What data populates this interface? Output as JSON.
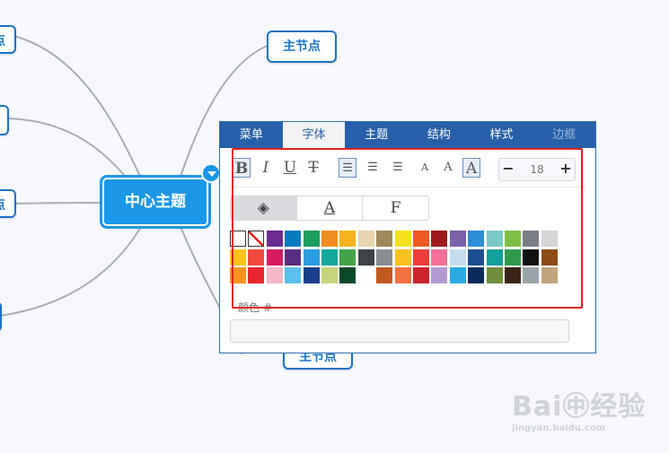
{
  "mindmap": {
    "center_topic": "中心主题",
    "node_top_right": "主节点",
    "node_bottom_right": "主节点",
    "left_node_fragment": "点"
  },
  "panel": {
    "tabs": [
      {
        "label": "菜单",
        "active": false
      },
      {
        "label": "字体",
        "active": true
      },
      {
        "label": "主题",
        "active": false
      },
      {
        "label": "结构",
        "active": false
      },
      {
        "label": "样式",
        "active": false
      },
      {
        "label": "边框",
        "active": false
      }
    ],
    "toolbar": {
      "bold": "B",
      "italic": "I",
      "underline": "U",
      "strike": "T",
      "align_left": "☰",
      "align_center": "☰",
      "align_right": "☰",
      "font_small": "A",
      "font_medium": "A",
      "font_large": "A",
      "size_minus": "−",
      "size_value": "18",
      "size_plus": "+"
    },
    "format_tabs": {
      "fill": "◈",
      "font_color": "A",
      "font_family": "F"
    },
    "color_label": "颜色 #",
    "color_value": "",
    "swatch_rows": [
      [
        "#ffffff",
        "#ffffff",
        "#6a2c91",
        "#0a7abf",
        "#1a9e5c",
        "#f18d1e",
        "#f4b51c",
        "#e8d4b0",
        "#a08a5a",
        "#f6e01a",
        "#f05a24",
        "#9e1b1b",
        "#7b61a8",
        "#2c8ed6",
        "#7ac9c9",
        "#7cbf44",
        "#7a7f87",
        "#d3d5d7"
      ],
      [
        "#f9c31a",
        "#f04a3e",
        "#d81b60",
        "#5b2d82",
        "#2a9ee0",
        "#12a89b",
        "#43a447",
        "#3d4348",
        "#8b8f93",
        "#fbc11e",
        "#ee3b3b",
        "#f36f98",
        "#c5dcf0",
        "#1c4f8f",
        "#14a09c",
        "#2d9b4b",
        "#111111",
        "#8f4b17"
      ],
      [
        "#f7941d",
        "#e8262c",
        "#f5b8c6",
        "#5bc0eb",
        "#1b3f8b",
        "#c6d47c",
        "#0d4a2a",
        "#ffffff",
        "#c1581d",
        "#f37042",
        "#c9252a",
        "#b49ad1",
        "#29a9e1",
        "#0a2a5a",
        "#6f8f3c",
        "#3b2417",
        "#9aa3a7",
        "#c4a47c"
      ]
    ]
  },
  "watermark": {
    "line1": "Bai㊥经验",
    "line2": "jingyan.baidu.com"
  }
}
